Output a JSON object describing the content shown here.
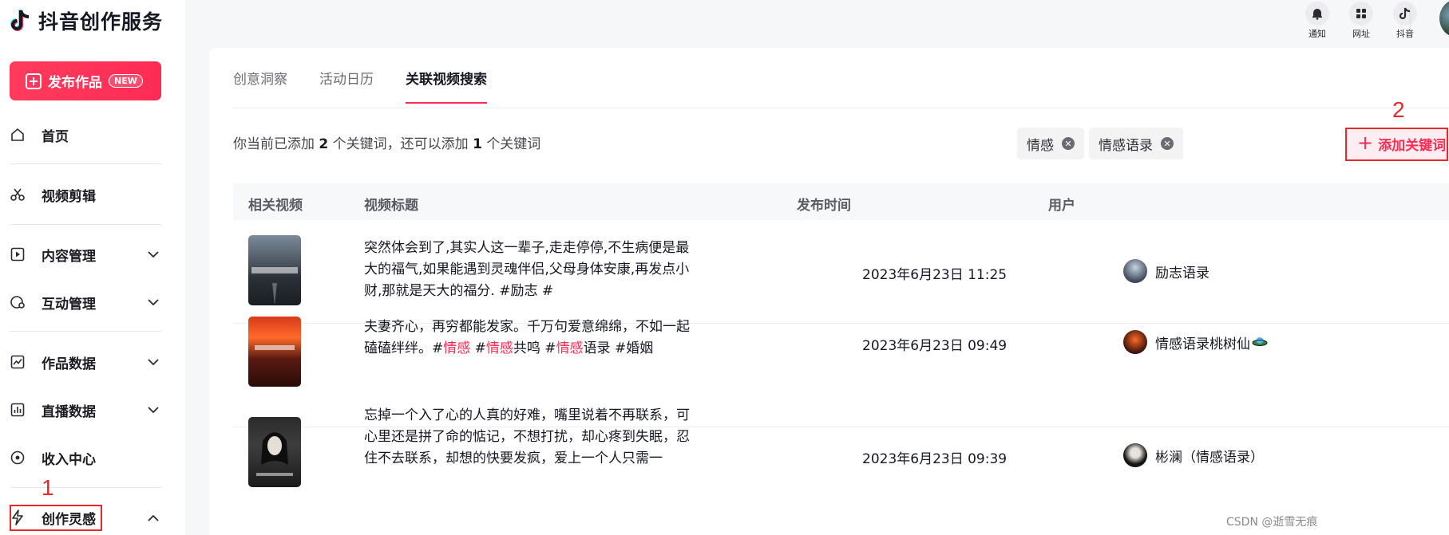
{
  "app": {
    "title": "抖音创作服务",
    "publish_label": "发布作品",
    "new_badge": "NEW"
  },
  "sidebar": {
    "items": [
      {
        "label": "首页",
        "icon": "home-icon"
      },
      {
        "label": "视频剪辑",
        "icon": "scissors-icon"
      },
      {
        "label": "内容管理",
        "icon": "play-square-icon"
      },
      {
        "label": "互动管理",
        "icon": "comment-icon"
      },
      {
        "label": "作品数据",
        "icon": "chart-icon"
      },
      {
        "label": "直播数据",
        "icon": "bar-chart-icon"
      },
      {
        "label": "收入中心",
        "icon": "target-icon"
      },
      {
        "label": "创作灵感",
        "icon": "lightning-icon"
      }
    ]
  },
  "topbar": {
    "notify_label": "通知",
    "web_label": "网址",
    "douyin_label": "抖音"
  },
  "tabs": [
    "创意洞察",
    "活动日历",
    "关联视频搜索"
  ],
  "info": {
    "prefix": "你当前已添加 ",
    "added_count": "2",
    "middle": " 个关键词，还可以添加 ",
    "remaining_count": "1",
    "suffix": " 个关键词"
  },
  "keywords": [
    "情感",
    "情感语录"
  ],
  "add_keyword_label": "添加关键词",
  "annotations": {
    "one": "1",
    "two": "2"
  },
  "table": {
    "headers": [
      "相关视频",
      "视频标题",
      "发布时间",
      "用户"
    ],
    "rows": [
      {
        "title_parts": [
          {
            "text": "突然体会到了,其实人这一辈子,走走停停,不生病便是最大的福气,如果能遇到灵魂伴侣,父母身体安康,再发点小财,那就是天大的福分. #励志 #",
            "hl": false
          }
        ],
        "time": "2023年6月23日 11:25",
        "user": "励志语录"
      },
      {
        "title_parts": [
          {
            "text": "夫妻齐心，再穷都能发家。千万句爱意绵绵，不如一起磕磕绊绊。#",
            "hl": false
          },
          {
            "text": "情感",
            "hl": true
          },
          {
            "text": " #",
            "hl": false
          },
          {
            "text": "情感",
            "hl": true
          },
          {
            "text": "共鸣 #",
            "hl": false
          },
          {
            "text": "情感",
            "hl": true
          },
          {
            "text": "语录 #婚姻",
            "hl": false
          }
        ],
        "time": "2023年6月23日 09:49",
        "user": "情感语录桃树仙"
      },
      {
        "title_parts": [
          {
            "text": "忘掉一个入了心的人真的好难，嘴里说着不再联系，可心里还是拼了命的惦记，不想打扰，却心疼到失眠，忍住不去联系，却想的快要发疯，爱上一个人只需一",
            "hl": false
          }
        ],
        "time": "2023年6月23日 09:39",
        "user": "彬澜（情感语录）"
      }
    ]
  },
  "watermark": "CSDN @逝雪无痕",
  "colors": {
    "brand": "#fe2c55",
    "annotation": "#e62a2a"
  }
}
